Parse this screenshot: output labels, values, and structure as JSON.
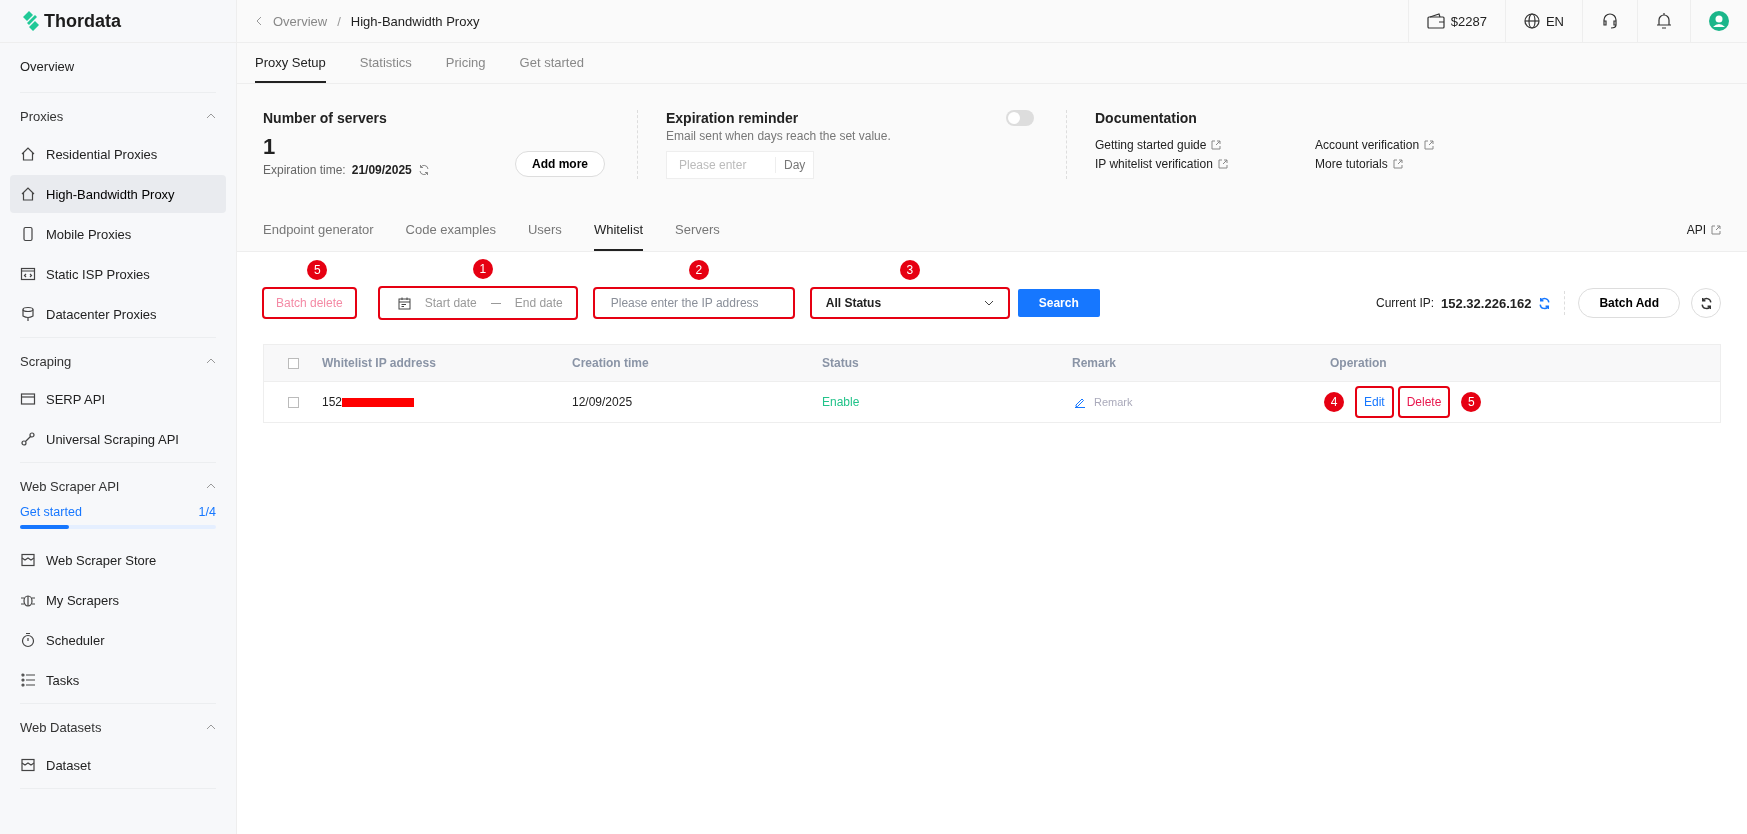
{
  "brand": {
    "name": "Thordata"
  },
  "sidebar": {
    "items": [
      {
        "kind": "link",
        "label": "Overview",
        "selected": false
      }
    ],
    "sections": [
      {
        "title": "Proxies",
        "expanded": true,
        "items": [
          {
            "label": "Residential Proxies",
            "selected": false
          },
          {
            "label": "High-Bandwidth Proxy",
            "selected": true
          },
          {
            "label": "Mobile Proxies",
            "selected": false
          },
          {
            "label": "Static ISP Proxies",
            "selected": false
          },
          {
            "label": "Datacenter Proxies",
            "selected": false
          }
        ]
      },
      {
        "title": "Scraping",
        "expanded": true,
        "items": [
          {
            "label": "SERP API",
            "selected": false
          },
          {
            "label": "Universal Scraping API",
            "selected": false
          }
        ]
      },
      {
        "title": "Web Scraper API",
        "expanded": true,
        "progress": {
          "label": "Get started",
          "count": "1/4",
          "level": 0.25
        },
        "items": [
          {
            "label": "Web Scraper Store",
            "selected": false
          },
          {
            "label": "My Scrapers",
            "selected": false
          },
          {
            "label": "Scheduler",
            "selected": false
          },
          {
            "label": "Tasks",
            "selected": false
          }
        ]
      },
      {
        "title": "Web Datasets",
        "expanded": true,
        "items": [
          {
            "label": "Dataset",
            "selected": false
          }
        ]
      }
    ]
  },
  "topbar": {
    "breadcrumb": [
      "Overview",
      "High-Bandwidth Proxy"
    ],
    "separator": "/",
    "balance": "$2287",
    "language": "EN"
  },
  "tabs": [
    {
      "label": "Proxy Setup",
      "selected": true
    },
    {
      "label": "Statistics",
      "selected": false
    },
    {
      "label": "Pricing",
      "selected": false
    },
    {
      "label": "Get started",
      "selected": false
    }
  ],
  "servers": {
    "title": "Number of servers",
    "count": "1",
    "expiry_label": "Expiration time:",
    "expiry_date": "21/09/2025",
    "button": "Add more"
  },
  "reminder": {
    "title": "Expiration reminder",
    "subtitle": "Email sent when days reach the set value.",
    "on": false,
    "placeholder": "Please enter",
    "unit": "Day"
  },
  "documentation": {
    "title": "Documentation",
    "links": [
      "Getting started guide",
      "Account verification",
      "IP whitelist verification",
      "More tutorials"
    ]
  },
  "subtabs": [
    {
      "label": "Endpoint generator",
      "selected": false
    },
    {
      "label": "Code examples",
      "selected": false
    },
    {
      "label": "Users",
      "selected": false
    },
    {
      "label": "Whitelist",
      "selected": true
    },
    {
      "label": "Servers",
      "selected": false
    }
  ],
  "api_link": "API",
  "toolbar": {
    "batch_delete": {
      "label": "Batch delete",
      "disabled": true,
      "annotation": "5"
    },
    "date_range": {
      "start": "Start date",
      "end": "End date",
      "annotation": "1"
    },
    "ip_field": {
      "placeholder": "Please enter the IP address",
      "annotation": "2"
    },
    "status_select": {
      "value": "All Status",
      "annotation": "3"
    },
    "search": "Search",
    "current_ip_label": "Current IP:",
    "current_ip": "152.32.226.162",
    "batch_add": "Batch Add"
  },
  "table": {
    "columns": [
      "Whitelist IP address",
      "Creation time",
      "Status",
      "Remark",
      "Operation"
    ],
    "header_checked": false,
    "rows": [
      {
        "checked": false,
        "ip": "152",
        "redacted": true,
        "created": "12/09/2025",
        "status": "Enable",
        "remark": "Remark",
        "edit": {
          "label": "Edit",
          "annotation": "4"
        },
        "delete": {
          "label": "Delete",
          "annotation": "5"
        }
      }
    ]
  }
}
